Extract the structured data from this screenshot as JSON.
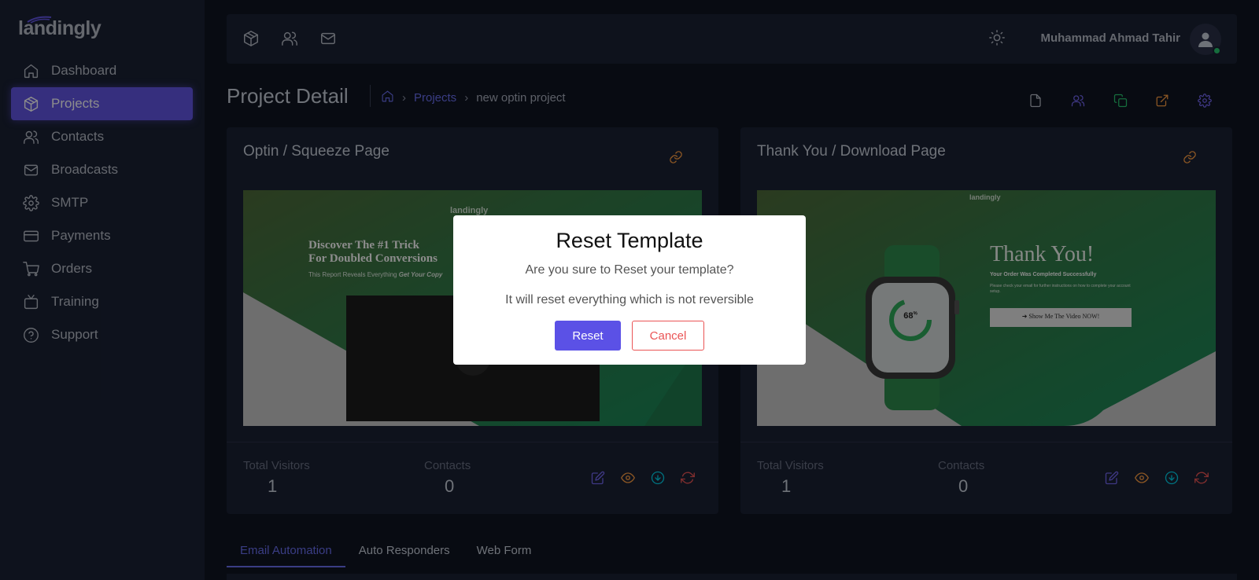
{
  "app": {
    "logo": "landingly"
  },
  "sidebar": {
    "items": [
      {
        "label": "Dashboard",
        "icon": "home-icon"
      },
      {
        "label": "Projects",
        "icon": "box-icon",
        "active": true
      },
      {
        "label": "Contacts",
        "icon": "users-icon"
      },
      {
        "label": "Broadcasts",
        "icon": "mail-icon"
      },
      {
        "label": "SMTP",
        "icon": "gear-icon"
      },
      {
        "label": "Payments",
        "icon": "credit-card-icon"
      },
      {
        "label": "Orders",
        "icon": "cart-icon"
      },
      {
        "label": "Training",
        "icon": "tv-icon"
      },
      {
        "label": "Support",
        "icon": "help-circle-icon"
      }
    ]
  },
  "topbar": {
    "icons": [
      "box-icon",
      "users-icon",
      "mail-icon"
    ],
    "user_name": "Muhammad Ahmad Tahir",
    "status": "online"
  },
  "header": {
    "title": "Project Detail",
    "breadcrumb": {
      "link": "Projects",
      "current": "new optin project"
    },
    "actions": [
      "file-icon",
      "users-icon",
      "copy-icon",
      "external-link-icon",
      "gear-icon"
    ]
  },
  "cards": [
    {
      "title": "Optin / Squeeze Page",
      "preview": {
        "logo": "landingly",
        "headline_1": "Discover The #1 Trick",
        "headline_2": "For Doubled Conversions",
        "sub": "This Report Reveals Everything",
        "sub_em": "Get Your Copy"
      },
      "visitors_label": "Total Visitors",
      "visitors": "1",
      "contacts_label": "Contacts",
      "contacts": "0"
    },
    {
      "title": "Thank You / Download Page",
      "preview": {
        "logo": "landingly",
        "headline": "Thank You!",
        "sub": "Your Order Was Completed Successfully",
        "body": "Please check your email for further instructions on how to complete your account setup.",
        "button": "Show Me The Video NOW!",
        "watch_value": "68",
        "watch_unit": "%"
      },
      "visitors_label": "Total Visitors",
      "visitors": "1",
      "contacts_label": "Contacts",
      "contacts": "0"
    }
  ],
  "tabs": [
    {
      "label": "Email Automation",
      "active": true
    },
    {
      "label": "Auto Responders"
    },
    {
      "label": "Web Form"
    }
  ],
  "modal": {
    "title": "Reset Template",
    "question": "Are you sure to Reset your template?",
    "note": "It will reset everything which is not reversible",
    "confirm": "Reset",
    "cancel": "Cancel"
  },
  "colors": {
    "accent": "#6356e5",
    "sidebar_bg": "#1a2134",
    "page_bg": "#0f1422",
    "edit": "#7367f0",
    "view": "#ff9f43",
    "download": "#00cfe8",
    "reset": "#ea5455",
    "copy": "#28c76f"
  }
}
